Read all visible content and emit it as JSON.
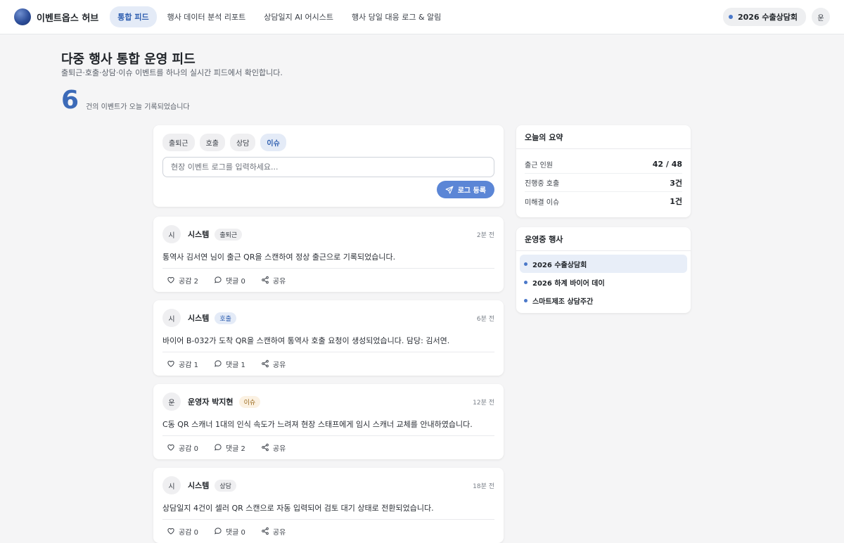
{
  "app": {
    "name": "이벤트옵스 허브"
  },
  "nav": {
    "items": [
      {
        "label": "통합 피드"
      },
      {
        "label": "행사 데이터 분석 리포트"
      },
      {
        "label": "상담일지 AI 어시스트"
      },
      {
        "label": "행사 당일 대응 로그 & 알림"
      }
    ]
  },
  "topbar": {
    "current_event": "2026 수출상담회",
    "user_avatar": "운"
  },
  "header": {
    "title": "다중 행사 통합 운영 피드",
    "subtitle": "출퇴근·호출·상담·이슈 이벤트를 하나의 실시간 피드에서 확인합니다.",
    "count": "6",
    "count_label": "건의 이벤트가 오늘 기록되었습니다"
  },
  "composer": {
    "chips": [
      {
        "label": "출퇴근"
      },
      {
        "label": "호출"
      },
      {
        "label": "상담"
      },
      {
        "label": "이슈"
      }
    ],
    "placeholder": "현장 이벤트 로그를 입력하세요...",
    "submit_label": "로그 등록"
  },
  "feed": [
    {
      "avatar": "시",
      "author": "시스템",
      "tag": "출퇴근",
      "time": "2분 전",
      "body": "통역사 김서연 님이 출근 QR을 스캔하여 정상 출근으로 기록되었습니다.",
      "like": "공감 2",
      "comment": "댓글 0",
      "share": "공유"
    },
    {
      "avatar": "시",
      "author": "시스템",
      "tag": "호출",
      "time": "6분 전",
      "body": "바이어 B-032가 도착 QR을 스캔하여 통역사 호출 요청이 생성되었습니다. 담당: 김서연.",
      "like": "공감 1",
      "comment": "댓글 1",
      "share": "공유"
    },
    {
      "avatar": "운",
      "author": "운영자 박지현",
      "tag": "이슈",
      "time": "12분 전",
      "body": "C동 QR 스캐너 1대의 인식 속도가 느려져 현장 스태프에게 임시 스캐너 교체를 안내하였습니다.",
      "like": "공감 0",
      "comment": "댓글 2",
      "share": "공유"
    },
    {
      "avatar": "시",
      "author": "시스템",
      "tag": "상담",
      "time": "18분 전",
      "body": "상담일지 4건이 셀러 QR 스캔으로 자동 입력되어 검토 대기 상태로 전환되었습니다.",
      "like": "공감 0",
      "comment": "댓글 0",
      "share": "공유"
    }
  ],
  "summary": {
    "title": "오늘의 요약",
    "rows": [
      {
        "label": "출근 인원",
        "value": "42 / 48"
      },
      {
        "label": "진행중 호출",
        "value": "3건"
      },
      {
        "label": "미해결 이슈",
        "value": "1건"
      }
    ]
  },
  "events": {
    "title": "운영중 행사",
    "items": [
      {
        "label": "2026 수출상담회"
      },
      {
        "label": "2026 하계 바이어 데이"
      },
      {
        "label": "스마트제조 상담주간"
      }
    ]
  },
  "colors": {
    "accent": "#3c6ab8",
    "button": "#5b86d6",
    "active_bg": "#e4ebf7"
  }
}
